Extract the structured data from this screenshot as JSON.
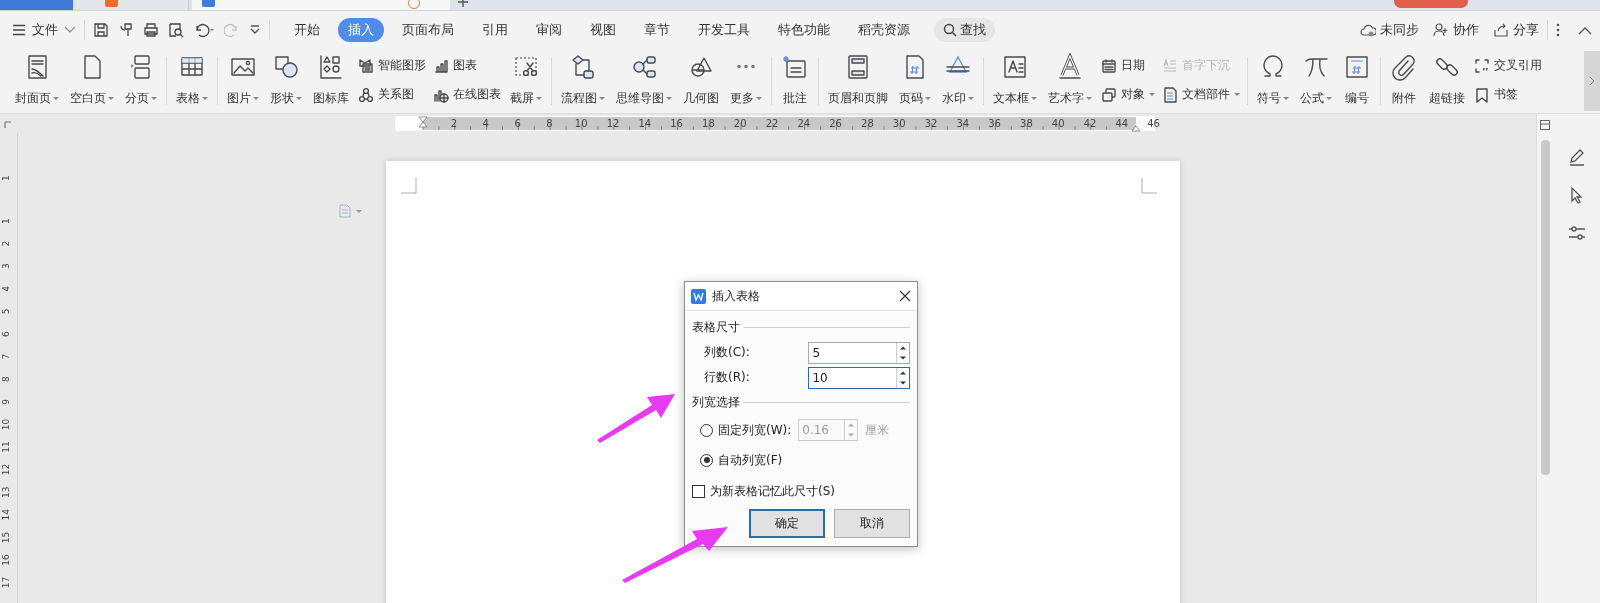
{
  "menu": {
    "file": "文件",
    "tabs": [
      {
        "label": "开始",
        "selected": false
      },
      {
        "label": "插入",
        "selected": true
      },
      {
        "label": "页面布局",
        "selected": false
      },
      {
        "label": "引用",
        "selected": false
      },
      {
        "label": "审阅",
        "selected": false
      },
      {
        "label": "视图",
        "selected": false
      },
      {
        "label": "章节",
        "selected": false
      },
      {
        "label": "开发工具",
        "selected": false
      },
      {
        "label": "特色功能",
        "selected": false
      },
      {
        "label": "稻壳资源",
        "selected": false
      }
    ],
    "search": "查找",
    "actions": [
      {
        "label": "未同步"
      },
      {
        "label": "协作"
      },
      {
        "label": "分享"
      }
    ]
  },
  "ribbon": [
    {
      "items": [
        {
          "kind": "large",
          "label": "封面页",
          "dropdown": true
        },
        {
          "kind": "large",
          "label": "空白页",
          "dropdown": true
        },
        {
          "kind": "large",
          "label": "分页",
          "dropdown": true
        }
      ]
    },
    {
      "items": [
        {
          "kind": "large",
          "label": "表格",
          "dropdown": true
        }
      ]
    },
    {
      "items": [
        {
          "kind": "large",
          "label": "图片",
          "dropdown": true
        },
        {
          "kind": "large",
          "label": "形状",
          "dropdown": true
        },
        {
          "kind": "large",
          "label": "图标库",
          "dropdown": false
        },
        {
          "kind": "stack",
          "items": [
            {
              "label": "智能图形",
              "dropdown": false,
              "disabled": false
            },
            {
              "label": "关系图",
              "dropdown": false,
              "disabled": false
            }
          ]
        },
        {
          "kind": "stack",
          "items": [
            {
              "label": "图表",
              "dropdown": false,
              "disabled": false
            },
            {
              "label": "在线图表",
              "dropdown": false,
              "disabled": false
            }
          ]
        },
        {
          "kind": "large",
          "label": "截屏",
          "dropdown": true
        }
      ]
    },
    {
      "items": [
        {
          "kind": "large",
          "label": "流程图",
          "dropdown": true
        },
        {
          "kind": "large",
          "label": "思维导图",
          "dropdown": true
        },
        {
          "kind": "large",
          "label": "几何图",
          "dropdown": false
        },
        {
          "kind": "large",
          "label": "更多",
          "dropdown": true
        }
      ]
    },
    {
      "items": [
        {
          "kind": "large",
          "label": "批注",
          "dropdown": false
        }
      ]
    },
    {
      "items": [
        {
          "kind": "large",
          "label": "页眉和页脚",
          "dropdown": false
        },
        {
          "kind": "large",
          "label": "页码",
          "dropdown": true
        },
        {
          "kind": "large",
          "label": "水印",
          "dropdown": true
        }
      ]
    },
    {
      "items": [
        {
          "kind": "large",
          "label": "文本框",
          "dropdown": true
        },
        {
          "kind": "large",
          "label": "艺术字",
          "dropdown": true
        },
        {
          "kind": "stack",
          "items": [
            {
              "label": "日期",
              "dropdown": false,
              "disabled": false
            },
            {
              "label": "对象",
              "dropdown": true,
              "disabled": false
            }
          ]
        },
        {
          "kind": "stack",
          "items": [
            {
              "label": "首字下沉",
              "dropdown": false,
              "disabled": true
            },
            {
              "label": "文档部件",
              "dropdown": true,
              "disabled": false
            }
          ]
        }
      ]
    },
    {
      "items": [
        {
          "kind": "large",
          "label": "符号",
          "dropdown": true
        },
        {
          "kind": "large",
          "label": "公式",
          "dropdown": true
        },
        {
          "kind": "large",
          "label": "编号",
          "dropdown": false
        }
      ]
    },
    {
      "items": [
        {
          "kind": "large",
          "label": "附件",
          "dropdown": false
        },
        {
          "kind": "large",
          "label": "超链接",
          "dropdown": false
        },
        {
          "kind": "stack",
          "items": [
            {
              "label": "交叉引用",
              "dropdown": false,
              "disabled": false
            },
            {
              "label": "书签",
              "dropdown": false,
              "disabled": false
            }
          ]
        }
      ]
    }
  ],
  "ruler": {
    "labels": [
      "2",
      "4",
      "6",
      "8",
      "10",
      "12",
      "14",
      "16",
      "18",
      "20",
      "22",
      "24",
      "26",
      "28",
      "30",
      "32",
      "34",
      "36",
      "38",
      "40",
      "42",
      "44",
      "46"
    ]
  },
  "vertical_ruler": {
    "labels": [
      "1",
      "1",
      "2",
      "3",
      "4",
      "5",
      "6",
      "7",
      "8",
      "9",
      "10",
      "11",
      "12",
      "13",
      "14",
      "15",
      "16",
      "17"
    ]
  },
  "dialog": {
    "title": "插入表格",
    "size_section": "表格尺寸",
    "fields": [
      {
        "label": "列数(C):",
        "value": "5",
        "focused": false
      },
      {
        "label": "行数(R):",
        "value": "10",
        "focused": true
      }
    ],
    "width_section": "列宽选择",
    "options": [
      {
        "label": "固定列宽(W):",
        "selected": false,
        "width_field": {
          "value": "0.16",
          "unit": "厘米",
          "disabled": true
        }
      },
      {
        "label": "自动列宽(F)",
        "selected": true
      }
    ],
    "remember": {
      "label": "为新表格记忆此尺寸(S)",
      "checked": false
    },
    "buttons": [
      {
        "label": "确定",
        "default": true
      },
      {
        "label": "取消",
        "default": false
      }
    ]
  }
}
